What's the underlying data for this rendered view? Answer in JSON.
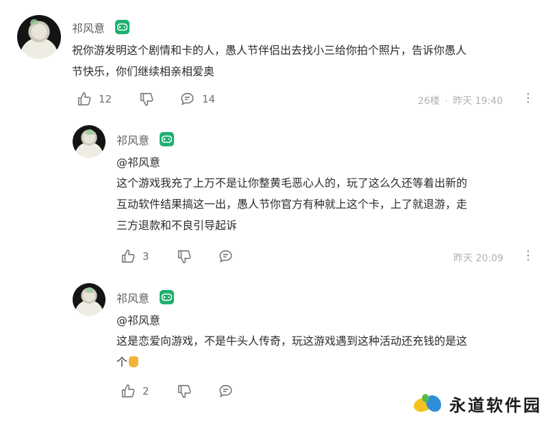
{
  "comments": [
    {
      "username": "祁风意",
      "lines": [
        "祝你游发明这个剧情和卡的人，愚人节伴侣出去找小三给你拍个照片，告诉你愚人",
        "节快乐，你们继续相亲相爱奥"
      ],
      "likes": "12",
      "replies": "14",
      "floor": "26楼",
      "separator": "·",
      "time": "昨天 19:40"
    },
    {
      "username": "祁风意",
      "mention": "@祁风意",
      "lines": [
        "这个游戏我充了上万不是让你整黄毛恶心人的，玩了这么久还等着出新的",
        "互动软件结果搞这一出，愚人节你官方有种就上这个卡，上了就退游，走",
        "三方退款和不良引导起诉"
      ],
      "likes": "3",
      "time": "昨天 20:09"
    },
    {
      "username": "祁风意",
      "mention": "@祁风意",
      "lines": [
        "这是恋爱向游戏，不是牛头人传奇，玩这游戏遇到这种活动还充钱的是这",
        "个"
      ],
      "likes": "2"
    }
  ],
  "icons": {
    "like": "thumbs-up-icon",
    "dislike": "thumbs-down-icon",
    "reply": "comment-icon",
    "more": "more-vertical-icon",
    "badge": "gamepad-icon",
    "emoji": "thumbs-up-emoji"
  },
  "colors": {
    "badge": "#1fb070",
    "meta": "#b0b0b0",
    "text": "#2b2b2b"
  },
  "watermark": {
    "text": "永道软件园"
  }
}
